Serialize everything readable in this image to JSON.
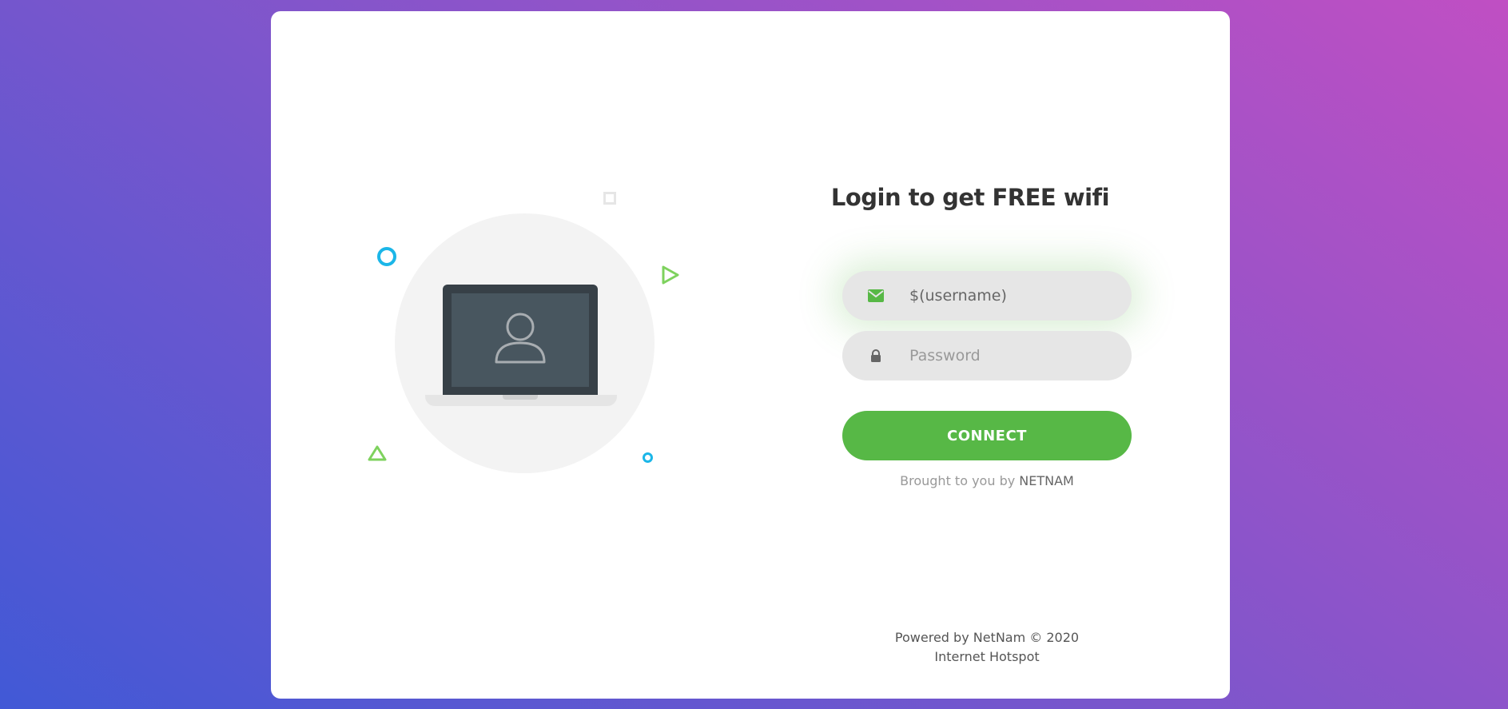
{
  "login": {
    "title": "Login to get FREE wifi",
    "username": {
      "value": "$(username)",
      "icon": "envelope-icon"
    },
    "password": {
      "placeholder": "Password",
      "icon": "lock-icon"
    },
    "connect_label": "CONNECT",
    "brought_prefix": "Brought to you by",
    "brought_brand": "NETNAM"
  },
  "footer": {
    "powered": "Powered by NetNam © 2020",
    "subtitle": "Internet Hotspot"
  },
  "colors": {
    "accent_green": "#57b846",
    "deco_blue": "#1bb6e8",
    "field_bg": "#e6e6e6",
    "title_text": "#333333"
  },
  "illustration": {
    "icons": [
      "laptop-icon",
      "user-icon"
    ]
  }
}
